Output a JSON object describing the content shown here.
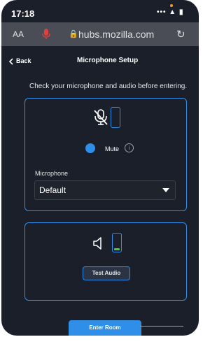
{
  "status_bar": {
    "time": "17:18",
    "icons": "••• ▲ ▮"
  },
  "browser": {
    "text_size_label": "AA",
    "url": "hubs.mozilla.com"
  },
  "header": {
    "back_label": "Back",
    "title": "Microphone Setup"
  },
  "subtitle": "Check your microphone and audio before entering.",
  "microphone_panel": {
    "mute_label": "Mute",
    "info_glyph": "i",
    "field_label": "Microphone",
    "selected_device": "Default"
  },
  "audio_panel": {
    "test_button_label": "Test Audio"
  },
  "enter_button_label": "Enter Room",
  "colors": {
    "accent": "#2f8fe8",
    "background": "#1b1f2a",
    "level": "#3ecf4a",
    "mic_red": "#e0413c"
  }
}
